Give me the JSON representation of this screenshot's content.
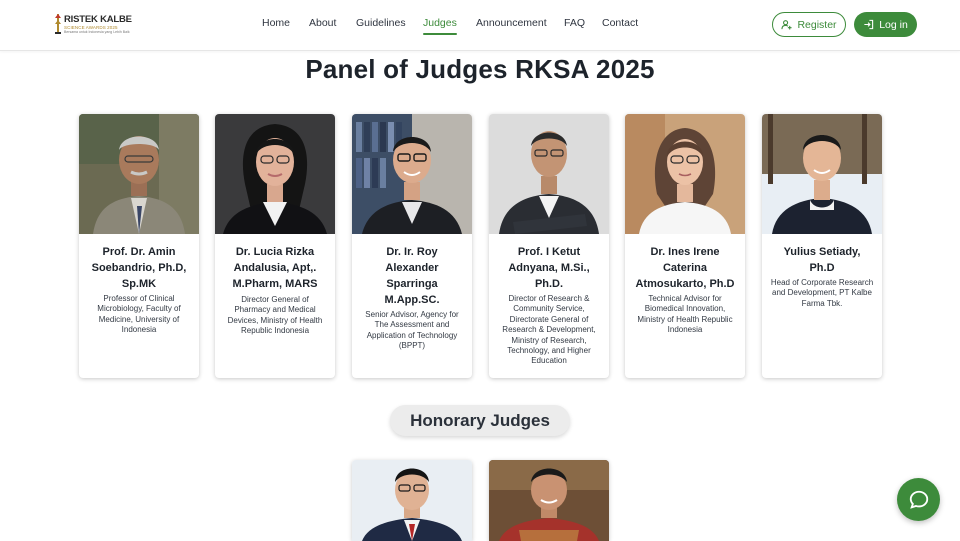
{
  "brand": {
    "name": "RISTEK KALBE",
    "tagline": "SCIENCE AWARDS 2025",
    "subline": "Bersama untuk Indonesia yang Lebih Baik"
  },
  "nav": {
    "items": [
      {
        "label": "Home"
      },
      {
        "label": "About"
      },
      {
        "label": "Guidelines"
      },
      {
        "label": "Judges",
        "active": true
      },
      {
        "label": "Announcement"
      },
      {
        "label": "FAQ"
      },
      {
        "label": "Contact"
      }
    ],
    "register_label": "Register",
    "login_label": "Log in"
  },
  "page": {
    "title": "Panel of Judges RKSA 2025",
    "honorary_title": "Honorary Judges"
  },
  "judges": [
    {
      "name": "Prof. Dr. Amin Soebandrio, Ph.D, Sp.MK",
      "role": "Professor of Clinical Microbiology, Faculty of Medicine, University of Indonesia"
    },
    {
      "name": "Dr. Lucia Rizka Andalusia, Apt,. M.Pharm, MARS",
      "role": "Director General of Pharmacy and Medical Devices, Ministry of Health Republic Indonesia"
    },
    {
      "name": "Dr. Ir. Roy Alexander Sparringa M.App.SC.",
      "role": "Senior Advisor, Agency for The Assessment and Application of Technology (BPPT)"
    },
    {
      "name": "Prof. I Ketut Adnyana, M.Si., Ph.D.",
      "role": "Director of Research & Community Service, Directorate General of Research & Development, Ministry of Research, Technology, and Higher Education"
    },
    {
      "name": "Dr. Ines Irene Caterina Atmosukarto, Ph.D",
      "role": "Technical Advisor for Biomedical Innovation, Ministry of Health Republic Indonesia"
    },
    {
      "name": "Yulius Setiady, Ph.D",
      "role": "Head of Corporate Research and Development, PT Kalbe Farma Tbk."
    }
  ],
  "icons": {
    "register": "user-plus-icon",
    "login": "login-icon",
    "chat": "chat-bubble-icon"
  },
  "colors": {
    "accent": "#3d8b3b",
    "title": "#1d232b"
  }
}
